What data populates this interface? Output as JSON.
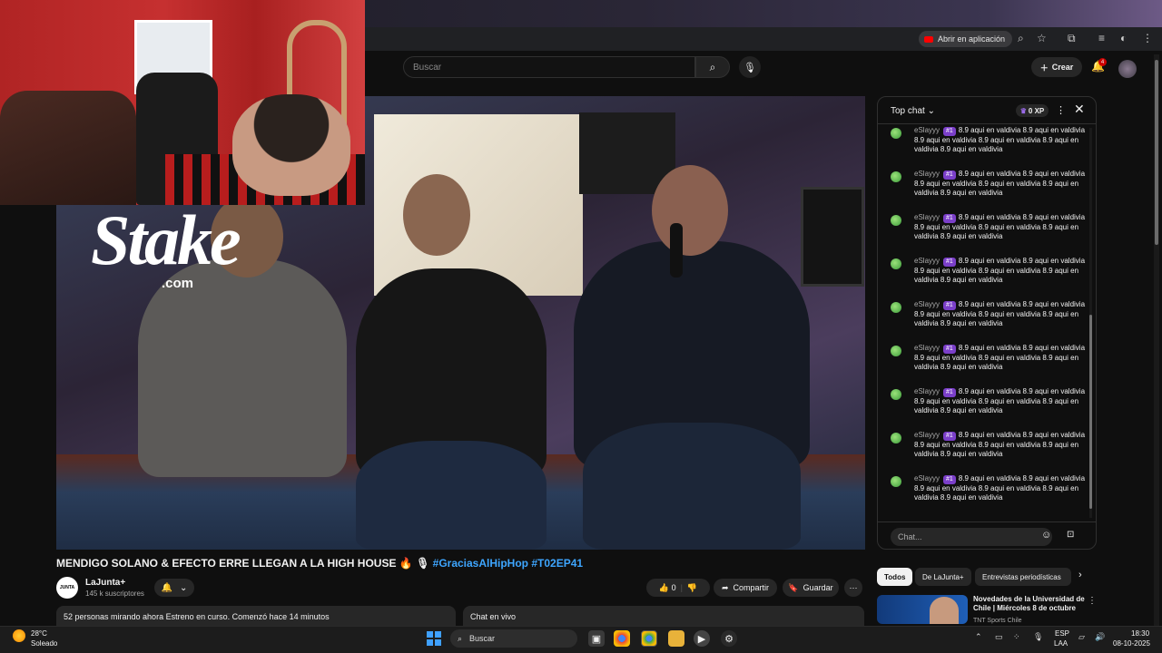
{
  "browser": {
    "open_in_app": "Abrir en aplicación"
  },
  "header": {
    "search_placeholder": "Buscar",
    "create_label": "Crear",
    "notifications_count": "4"
  },
  "video": {
    "overlay_logo": "Stake",
    "overlay_logo_sub": ".com",
    "title": "MENDIGO SOLANO & EFECTO ERRE LLEGAN A LA HIGH HOUSE 🔥 🎙 ",
    "title_tags": "#GraciasAlHipHop #T02EP41",
    "channel": "LaJunta+",
    "channel_avatar_text": "JUNTA",
    "subscribers": "145 k suscriptores",
    "likes": "0",
    "share_label": "Compartir",
    "save_label": "Guardar",
    "description_line": "52 personas mirando ahora  Estreno en curso. Comenzó hace 14 minutos",
    "live_chat_label": "Chat en vivo"
  },
  "chat": {
    "title": "Top chat",
    "xp": "0 XP",
    "input_placeholder": "Chat...",
    "messages": [
      {
        "author": "eSlayyy",
        "badge": "#1",
        "text": "8.9 aqui en valdivia 8.9 aqui en valdivia 8.9 aqui en valdivia 8.9 aqui en valdivia 8.9 aqui en valdivia 8.9 aqui en valdivia"
      },
      {
        "author": "eSlayyy",
        "badge": "#1",
        "text": "8.9 aqui en valdivia 8.9 aqui en valdivia 8.9 aqui en valdivia 8.9 aqui en valdivia 8.9 aqui en valdivia 8.9 aqui en valdivia"
      },
      {
        "author": "eSlayyy",
        "badge": "#1",
        "text": "8.9 aqui en valdivia 8.9 aqui en valdivia 8.9 aqui en valdivia 8.9 aqui en valdivia 8.9 aqui en valdivia 8.9 aqui en valdivia"
      },
      {
        "author": "eSlayyy",
        "badge": "#1",
        "text": "8.9 aqui en valdivia 8.9 aqui en valdivia 8.9 aqui en valdivia 8.9 aqui en valdivia 8.9 aqui en valdivia 8.9 aqui en valdivia"
      },
      {
        "author": "eSlayyy",
        "badge": "#1",
        "text": "8.9 aqui en valdivia 8.9 aqui en valdivia 8.9 aqui en valdivia 8.9 aqui en valdivia 8.9 aqui en valdivia 8.9 aqui en valdivia"
      },
      {
        "author": "eSlayyy",
        "badge": "#1",
        "text": "8.9 aqui en valdivia 8.9 aqui en valdivia 8.9 aqui en valdivia 8.9 aqui en valdivia 8.9 aqui en valdivia 8.9 aqui en valdivia"
      },
      {
        "author": "eSlayyy",
        "badge": "#1",
        "text": "8.9 aqui en valdivia 8.9 aqui en valdivia 8.9 aqui en valdivia 8.9 aqui en valdivia 8.9 aqui en valdivia 8.9 aqui en valdivia"
      },
      {
        "author": "eSlayyy",
        "badge": "#1",
        "text": "8.9 aqui en valdivia 8.9 aqui en valdivia 8.9 aqui en valdivia 8.9 aqui en valdivia 8.9 aqui en valdivia 8.9 aqui en valdivia"
      },
      {
        "author": "eSlayyy",
        "badge": "#1",
        "text": "8.9 aqui en valdivia 8.9 aqui en valdivia 8.9 aqui en valdivia 8.9 aqui en valdivia 8.9 aqui en valdivia 8.9 aqui en valdivia"
      }
    ]
  },
  "recommendations": {
    "chips": [
      "Todos",
      "De LaJunta+",
      "Entrevistas periodísticas"
    ],
    "item": {
      "title": "Novedades de la Universidad de Chile | Miércoles 8 de octubre",
      "channel": "TNT Sports Chile"
    }
  },
  "taskbar": {
    "temperature": "28°C",
    "weather": "Soleado",
    "search_label": "Buscar",
    "lang_line1": "ESP",
    "lang_line2": "LAA",
    "time": "18:30",
    "date": "08-10-2025"
  },
  "colors": {
    "accent_red": "#ff0000",
    "link_blue": "#3ea6ff",
    "member_badge": "#7b3fc9"
  }
}
